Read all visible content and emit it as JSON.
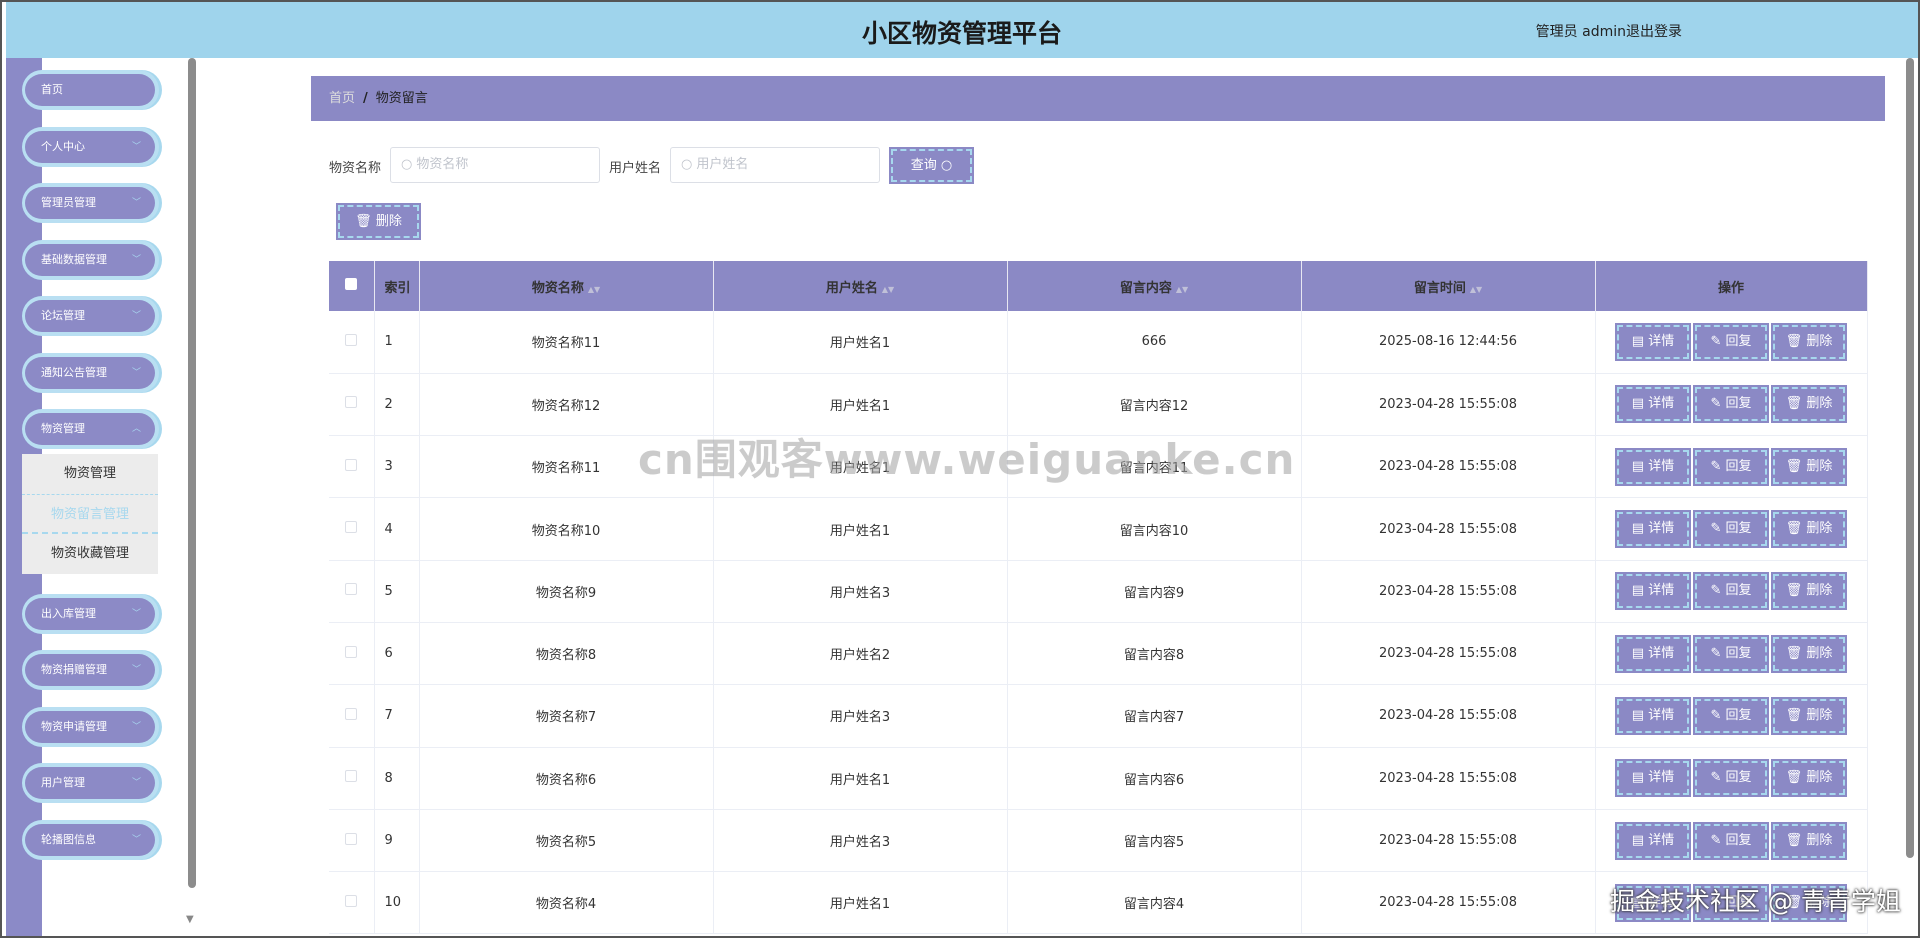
{
  "header": {
    "title": "小区物资管理平台",
    "user": "管理员 admin",
    "logout": "退出登录"
  },
  "sidebar": {
    "items": [
      {
        "label": "首页",
        "chevron": false
      },
      {
        "label": "个人中心",
        "chevron": true
      },
      {
        "label": "管理员管理",
        "chevron": true
      },
      {
        "label": "基础数据管理",
        "chevron": true
      },
      {
        "label": "论坛管理",
        "chevron": true
      },
      {
        "label": "通知公告管理",
        "chevron": true
      },
      {
        "label": "物资管理",
        "chevron": true,
        "expanded": true
      }
    ],
    "submenu": [
      {
        "label": "物资管理"
      },
      {
        "label": "物资留言管理",
        "active": true
      },
      {
        "label": "物资收藏管理"
      }
    ],
    "items_after": [
      {
        "label": "出入库管理"
      },
      {
        "label": "物资捐赠管理"
      },
      {
        "label": "物资申请管理"
      },
      {
        "label": "用户管理"
      },
      {
        "label": "轮播图信息"
      }
    ]
  },
  "breadcrumb": {
    "home": "首页",
    "sep": "/",
    "current": "物资留言"
  },
  "search": {
    "name_label": "物资名称",
    "name_placeholder": "物资名称",
    "user_label": "用户姓名",
    "user_placeholder": "用户姓名",
    "query_button": "查询",
    "delete_button": "删除"
  },
  "table": {
    "headers": [
      "索引",
      "物资名称",
      "用户姓名",
      "留言内容",
      "留言时间",
      "操作"
    ],
    "rows": [
      {
        "index": "1",
        "name": "物资名称11",
        "user": "用户姓名1",
        "content": "666",
        "time": "2025-08-16 12:44:56"
      },
      {
        "index": "2",
        "name": "物资名称12",
        "user": "用户姓名1",
        "content": "留言内容12",
        "time": "2023-04-28 15:55:08"
      },
      {
        "index": "3",
        "name": "物资名称11",
        "user": "用户姓名1",
        "content": "留言内容11",
        "time": "2023-04-28 15:55:08"
      },
      {
        "index": "4",
        "name": "物资名称10",
        "user": "用户姓名1",
        "content": "留言内容10",
        "time": "2023-04-28 15:55:08"
      },
      {
        "index": "5",
        "name": "物资名称9",
        "user": "用户姓名3",
        "content": "留言内容9",
        "time": "2023-04-28 15:55:08"
      },
      {
        "index": "6",
        "name": "物资名称8",
        "user": "用户姓名2",
        "content": "留言内容8",
        "time": "2023-04-28 15:55:08"
      },
      {
        "index": "7",
        "name": "物资名称7",
        "user": "用户姓名3",
        "content": "留言内容7",
        "time": "2023-04-28 15:55:08"
      },
      {
        "index": "8",
        "name": "物资名称6",
        "user": "用户姓名1",
        "content": "留言内容6",
        "time": "2023-04-28 15:55:08"
      },
      {
        "index": "9",
        "name": "物资名称5",
        "user": "用户姓名3",
        "content": "留言内容5",
        "time": "2023-04-28 15:55:08"
      },
      {
        "index": "10",
        "name": "物资名称4",
        "user": "用户姓名1",
        "content": "留言内容4",
        "time": "2023-04-28 15:55:08"
      }
    ],
    "actions": {
      "detail": "详情",
      "reply": "回复",
      "delete": "删除"
    }
  },
  "watermark": "cn围观客www.weiguanke.cn",
  "corner_mark": "掘金技术社区 @ 青青学姐",
  "colors": {
    "header": "#9fd4ec",
    "accent": "#8b89c5",
    "highlight": "#a7d8ee"
  }
}
